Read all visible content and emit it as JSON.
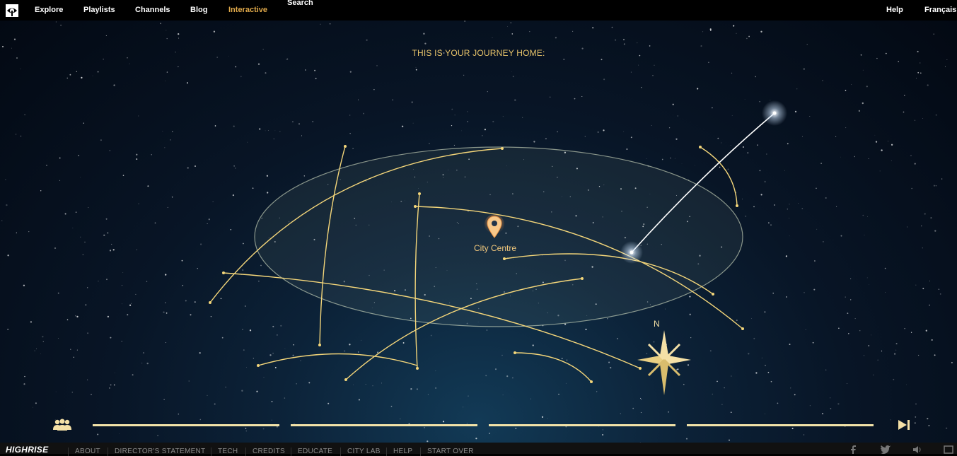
{
  "topnav": {
    "logo_icon": "eye-icon",
    "items": [
      "Explore",
      "Playlists",
      "Channels",
      "Blog",
      "Interactive"
    ],
    "active_item": "Interactive",
    "search_label": "Search",
    "help_label": "Help",
    "language_label": "Français"
  },
  "main": {
    "headline": "THIS IS YOUR JOURNEY HOME:",
    "pin_label": "City Centre",
    "compass_label": "N",
    "accent_color": "#e7c36a"
  },
  "bottom_controls": {
    "left_icon": "people-icon",
    "right_icon": "skip-next-icon",
    "progress_segments": 4
  },
  "footer": {
    "brand": "HIGHRISE",
    "items": [
      "ABOUT",
      "DIRECTOR'S STATEMENT",
      "TECH",
      "CREDITS",
      "EDUCATE",
      "CITY LAB",
      "HELP",
      "START OVER"
    ],
    "social_icons": [
      "facebook-icon",
      "twitter-icon",
      "sound-icon",
      "fullscreen-icon"
    ]
  }
}
